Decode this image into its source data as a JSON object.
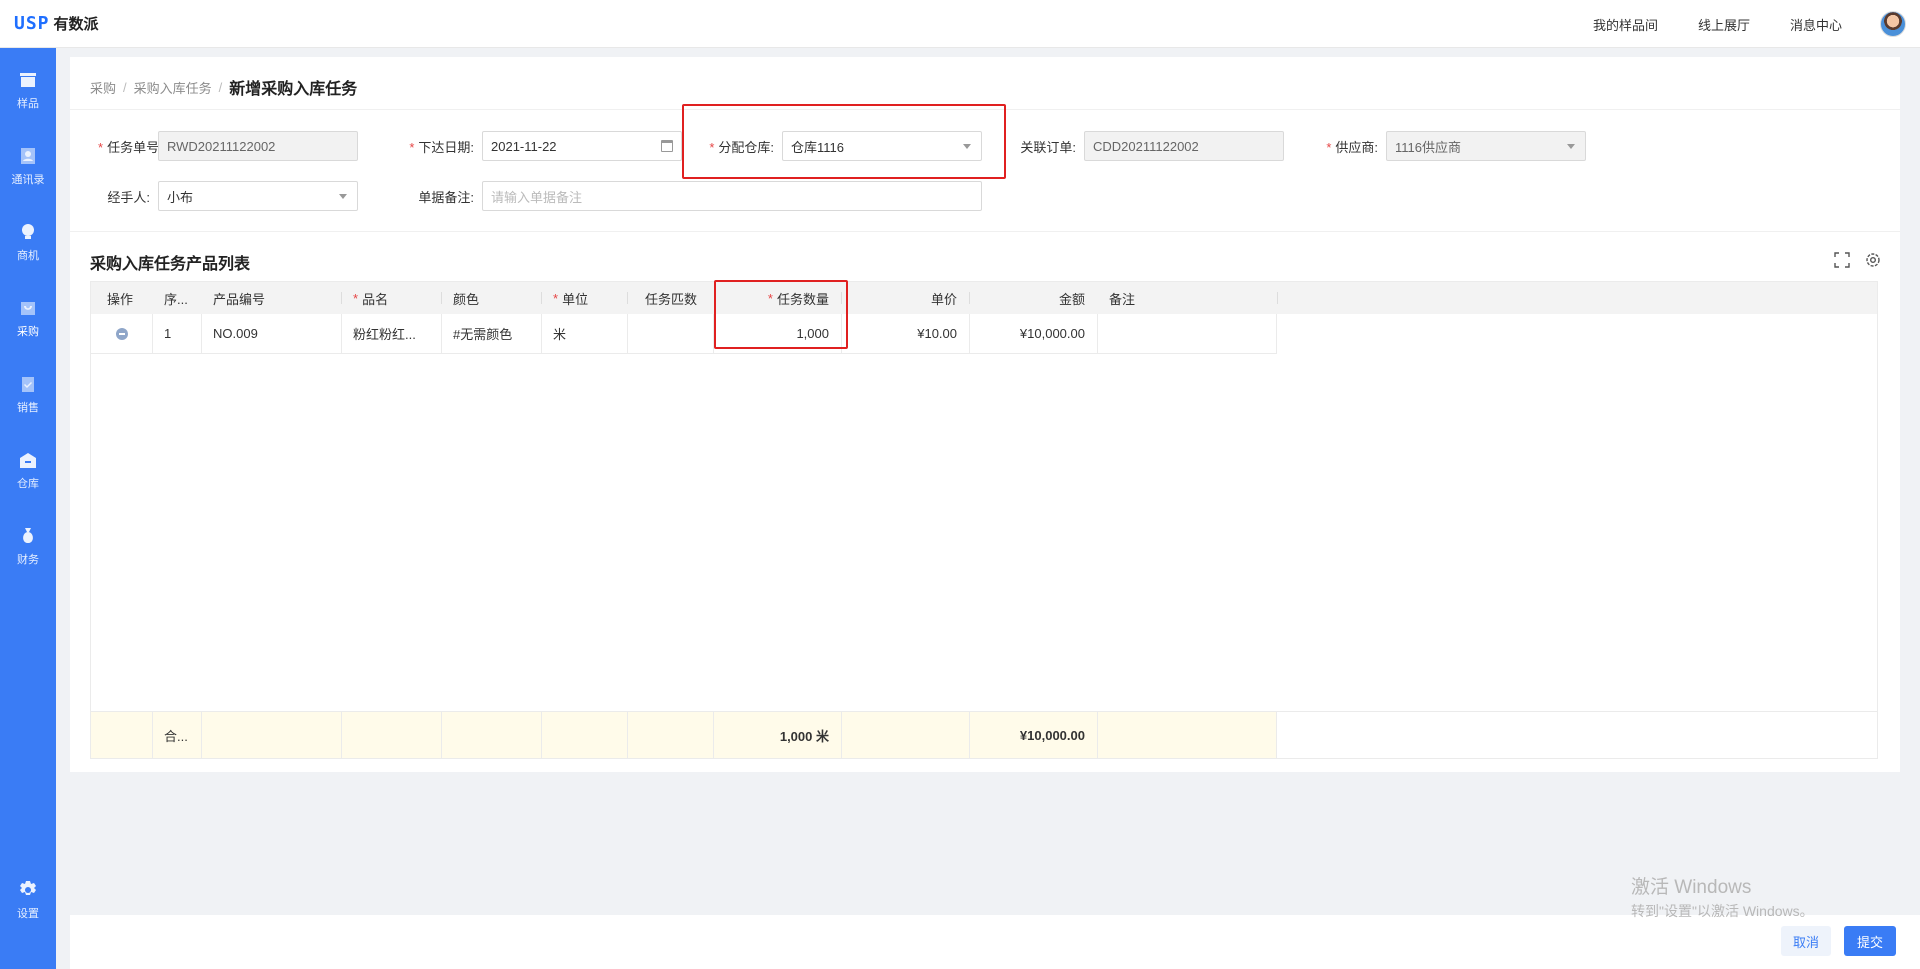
{
  "brand": {
    "mark": "USP",
    "name": "有数派"
  },
  "topnav": {
    "links": [
      "我的样品间",
      "线上展厅",
      "消息中心"
    ]
  },
  "sidebar": {
    "items": [
      {
        "label": "样品",
        "icon": "box-icon"
      },
      {
        "label": "通讯录",
        "icon": "contact-icon"
      },
      {
        "label": "商机",
        "icon": "lightbulb-icon"
      },
      {
        "label": "采购",
        "icon": "cart-icon",
        "active": true
      },
      {
        "label": "销售",
        "icon": "clipboard-check-icon"
      },
      {
        "label": "仓库",
        "icon": "warehouse-icon"
      },
      {
        "label": "财务",
        "icon": "money-bag-icon"
      }
    ],
    "settings_label": "设置"
  },
  "breadcrumb": {
    "items": [
      "采购",
      "采购入库任务"
    ],
    "current": "新增采购入库任务"
  },
  "form": {
    "task_no": {
      "label": "任务单号:",
      "value": "RWD20211122002"
    },
    "issue_date": {
      "label": "下达日期:",
      "value": "2021-11-22"
    },
    "warehouse": {
      "label": "分配仓库:",
      "value": "仓库1116"
    },
    "related_order": {
      "label": "关联订单:",
      "value": "CDD20211122002"
    },
    "supplier": {
      "label": "供应商:",
      "value": "1116供应商"
    },
    "handler": {
      "label": "经手人:",
      "value": "小布"
    },
    "remark": {
      "label": "单据备注:",
      "placeholder": "请输入单据备注"
    }
  },
  "section": {
    "title": "采购入库任务产品列表"
  },
  "table": {
    "columns": [
      "操作",
      "序...",
      "产品编号",
      "品名",
      "颜色",
      "单位",
      "任务匹数",
      "任务数量",
      "单价",
      "金额",
      "备注"
    ],
    "rows": [
      {
        "index": "1",
        "product_no": "NO.009",
        "name": "粉红粉红...",
        "color": "#无需颜色",
        "unit": "米",
        "pieces": "",
        "quantity": "1,000",
        "unit_price": "¥10.00",
        "amount": "¥10,000.00",
        "remark": ""
      }
    ],
    "footer": {
      "label": "合...",
      "quantity": "1,000 米",
      "amount": "¥10,000.00"
    }
  },
  "actions": {
    "cancel": "取消",
    "submit": "提交"
  },
  "watermark": {
    "line1": "激活 Windows",
    "line2": "转到\"设置\"以激活 Windows。"
  }
}
